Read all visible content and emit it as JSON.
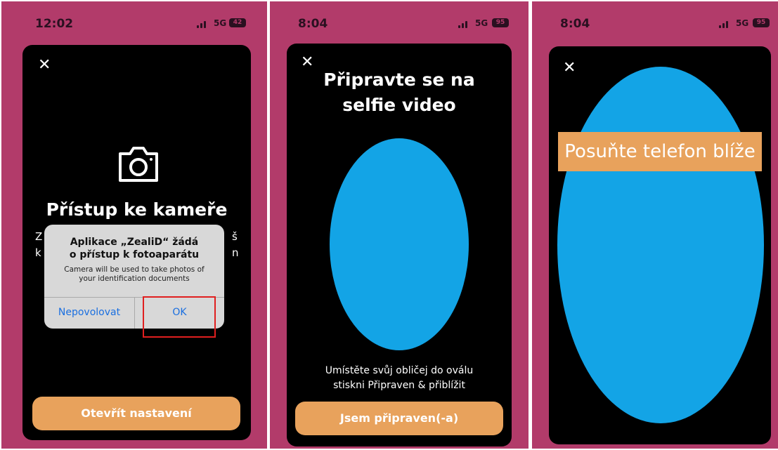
{
  "colors": {
    "background": "#b23b6a",
    "screen": "#000000",
    "accent_button": "#e8a25c",
    "oval": "#13a4e6",
    "dialog_link": "#1a6fe0",
    "highlight": "#e01f1f"
  },
  "panels": [
    {
      "status": {
        "time": "12:02",
        "network": "5G",
        "battery": "42"
      },
      "icons": {
        "close": "close-icon",
        "camera": "camera-icon"
      },
      "title": "Přístup ke kameře",
      "body_fragments": {
        "left_1": "Z",
        "left_2": "k",
        "right_1": "š",
        "right_2": "n"
      },
      "dialog": {
        "title_line1": "Aplikace „ZealiD“ žádá",
        "title_line2": "o přístup k fotoaparátu",
        "message_line1": "Camera will be used to take photos of",
        "message_line2": "your identification documents",
        "deny_label": "Nepovolovat",
        "allow_label": "OK"
      },
      "button": "Otevřít nastavení"
    },
    {
      "status": {
        "time": "8:04",
        "network": "5G",
        "battery": "95"
      },
      "title_line1": "Připravte se na",
      "title_line2": "selfie video",
      "instruction_line1": "Umístěte svůj obličej do oválu",
      "instruction_line2": "stiskni Připraven & přiblížit",
      "button": "Jsem připraven(-a)"
    },
    {
      "status": {
        "time": "8:04",
        "network": "5G",
        "battery": "95"
      },
      "banner": "Posuňte telefon blíže"
    }
  ]
}
